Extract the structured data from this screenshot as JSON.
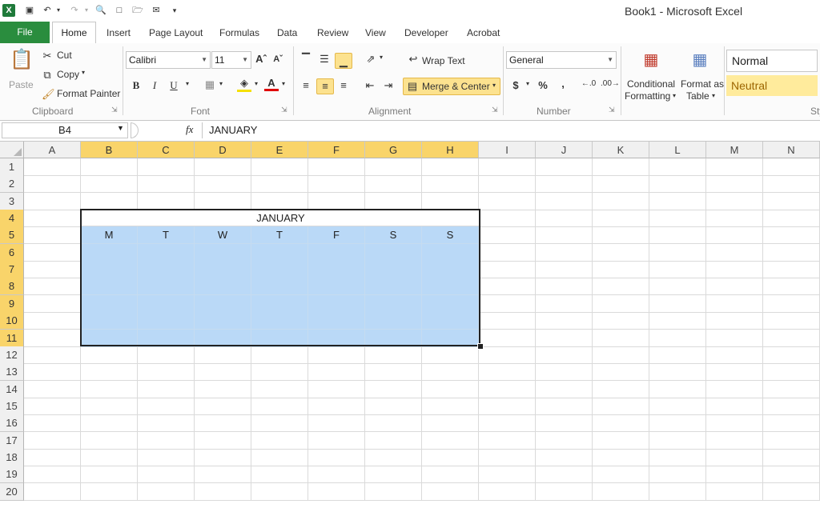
{
  "window": {
    "title": "Book1  -  Microsoft Excel"
  },
  "tabs": [
    {
      "label": "File"
    },
    {
      "label": "Home"
    },
    {
      "label": "Insert"
    },
    {
      "label": "Page Layout"
    },
    {
      "label": "Formulas"
    },
    {
      "label": "Data"
    },
    {
      "label": "Review"
    },
    {
      "label": "View"
    },
    {
      "label": "Developer"
    },
    {
      "label": "Acrobat"
    }
  ],
  "clipboard": {
    "paste": "Paste",
    "cut": "Cut",
    "copy": "Copy",
    "format_painter": "Format Painter",
    "group": "Clipboard"
  },
  "font": {
    "name": "Calibri",
    "size": "11",
    "bold": "B",
    "italic": "I",
    "underline": "U",
    "font_color_glyph": "A",
    "group": "Font"
  },
  "alignment": {
    "wrap_text": "Wrap Text",
    "merge_center": "Merge & Center",
    "group": "Alignment"
  },
  "number": {
    "format": "General",
    "currency": "$",
    "percent": "%",
    "comma": ",",
    "group": "Number"
  },
  "styles": {
    "conditional_formatting": [
      "Conditional",
      "Formatting"
    ],
    "format_as_table": [
      "Format as",
      "Table"
    ],
    "normal": "Normal",
    "neutral": "Neutral",
    "group": "Sty"
  },
  "formula_bar": {
    "name_box": "B4",
    "fx": "fx",
    "value": "JANUARY"
  },
  "sheet": {
    "columns": [
      "A",
      "B",
      "C",
      "D",
      "E",
      "F",
      "G",
      "H",
      "I",
      "J",
      "K",
      "L",
      "M",
      "N"
    ],
    "rows": [
      "1",
      "2",
      "3",
      "4",
      "5",
      "6",
      "7",
      "8",
      "9",
      "10",
      "11",
      "12",
      "13",
      "14",
      "15",
      "16",
      "17",
      "18",
      "19",
      "20"
    ],
    "merged_title": "JANUARY",
    "weekdays": [
      "M",
      "T",
      "W",
      "T",
      "F",
      "S",
      "S"
    ]
  },
  "colors": {
    "selection_header": "#f9d46a",
    "cell_fill": "#bad9f7",
    "file_tab": "#2a8d3e",
    "active_button": "#fce28f"
  }
}
